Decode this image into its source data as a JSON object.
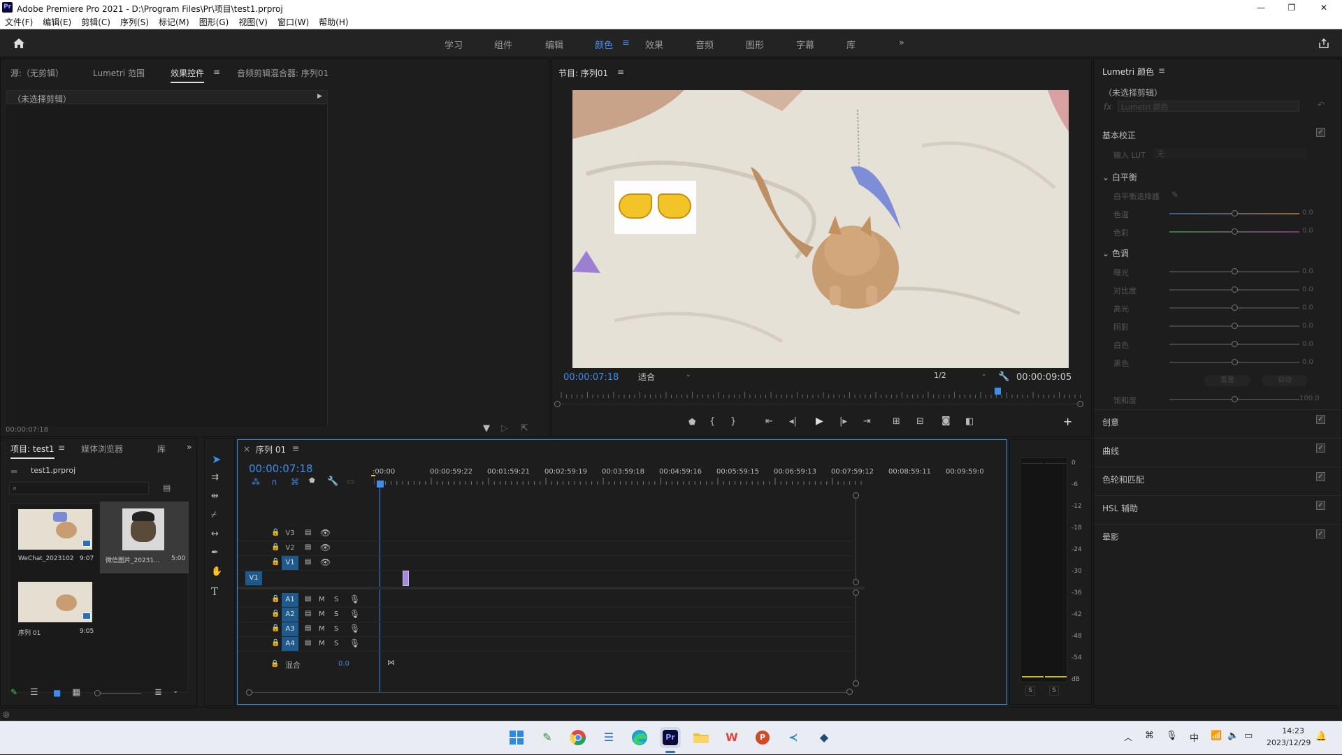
{
  "window": {
    "title": "Adobe Premiere Pro 2021 - D:\\Program Files\\Pr\\项目\\test1.prproj",
    "logo": "Pr",
    "minimize": "—",
    "maximize": "❐",
    "close": "✕"
  },
  "menu": [
    "文件(F)",
    "编辑(E)",
    "剪辑(C)",
    "序列(S)",
    "标记(M)",
    "图形(G)",
    "视图(V)",
    "窗口(W)",
    "帮助(H)"
  ],
  "workspaces": {
    "items": [
      "学习",
      "组件",
      "编辑",
      "颜色",
      "效果",
      "音频",
      "图形",
      "字幕",
      "库"
    ],
    "active": "颜色",
    "more": "»"
  },
  "source_panel": {
    "tabs": [
      "源:（无剪辑）",
      "Lumetri 范围",
      "效果控件",
      "音频剪辑混合器: 序列01"
    ],
    "active_tab": "效果控件",
    "no_clip": "（未选择剪辑）",
    "timecode": "00:00:07:18"
  },
  "program_monitor": {
    "title": "节目: 序列01",
    "timecode": "00:00:07:18",
    "fit": "适合",
    "resolution": "1/2",
    "duration": "00:00:09:05",
    "sticker_icon": "pointing-hands-emoji",
    "playhead_fraction": 0.83
  },
  "lumetri": {
    "title": "Lumetri 颜色",
    "no_clip": "（未选择剪辑）",
    "fx_label": "fx",
    "fx_value": "Lumetri 颜色",
    "basic": "基本校正",
    "input_lut": "输入 LUT",
    "input_lut_value": "无",
    "white_balance": "白平衡",
    "wb_selector": "白平衡选择器",
    "temp": "色温",
    "tint": "色彩",
    "tone": "色调",
    "tone_rows": [
      "曝光",
      "对比度",
      "高光",
      "阴影",
      "白色",
      "黑色"
    ],
    "zero": "0.0",
    "reset": "重置",
    "auto": "自动",
    "saturation": "饱和度",
    "saturation_value": "100.0",
    "sections": [
      "创意",
      "曲线",
      "色轮和匹配",
      "HSL 辅助",
      "晕影"
    ]
  },
  "project": {
    "tabs": [
      "项目: test1",
      "媒体浏览器",
      "库"
    ],
    "file": "test1.prproj",
    "items": [
      {
        "name": "WeChat_2023102...",
        "duration": "9:07"
      },
      {
        "name": "微信图片_20231...",
        "duration": "5:00"
      },
      {
        "name": "序列 01",
        "duration": "9:05"
      }
    ]
  },
  "timeline": {
    "tab": "序列 01",
    "close": "×",
    "timecode": "00:00:07:18",
    "ruler": [
      ":00:00",
      "00:00:59:22",
      "00:01:59:21",
      "00:02:59:19",
      "00:03:59:18",
      "00:04:59:16",
      "00:05:59:15",
      "00:06:59:13",
      "00:07:59:12",
      "00:08:59:11",
      "00:09:59:0"
    ],
    "video_tracks": [
      "V3",
      "V2",
      "V1"
    ],
    "source_patch": "V1",
    "audio_tracks": [
      "A1",
      "A2",
      "A3",
      "A4"
    ],
    "mix_label": "混合",
    "mix_value": "0.0",
    "m": "M",
    "s": "S"
  },
  "meter": {
    "scale": [
      "0",
      "-6",
      "-12",
      "-18",
      "-24",
      "-30",
      "-36",
      "-42",
      "-48",
      "-54",
      "dB"
    ],
    "solo": "S"
  },
  "taskbar": {
    "time": "14:23",
    "date": "2023/12/29",
    "ime": "中"
  }
}
